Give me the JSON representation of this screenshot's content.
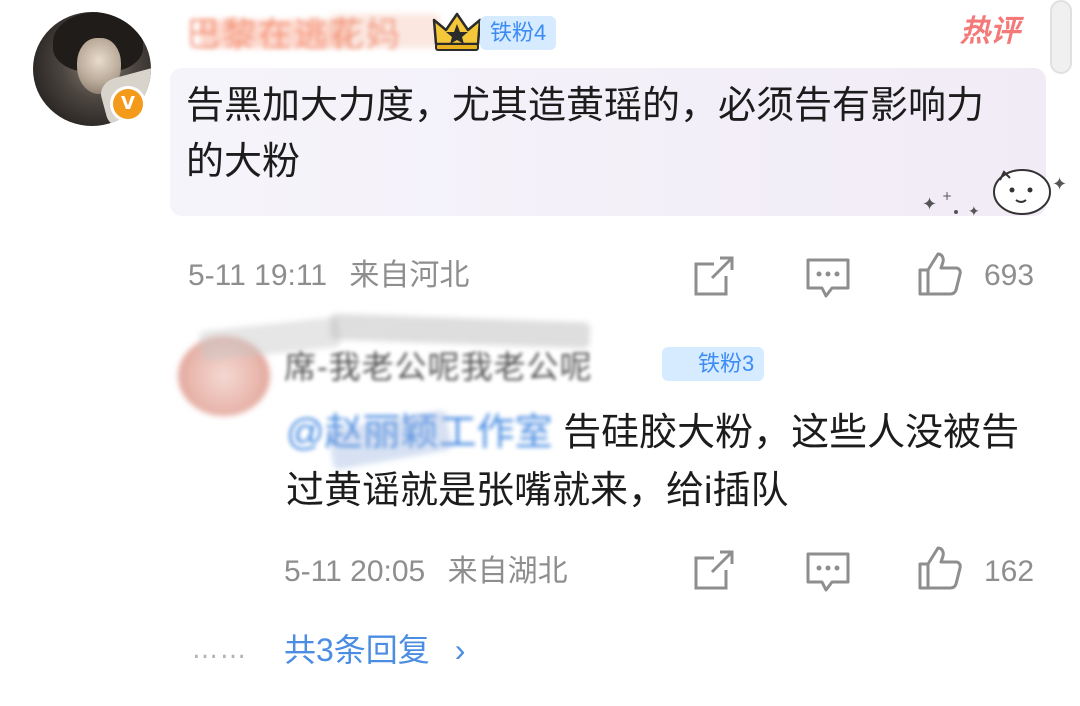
{
  "comment": {
    "username": "巴黎在逃花妈",
    "fan_badge": "铁粉4",
    "hot_tag": "热评",
    "text": "告黑加大力度，尤其造黄瑶的，必须告有影响力的大粉",
    "time": "5-11 19:11",
    "location": "来自河北",
    "likes": "693"
  },
  "reply": {
    "username": "席-我老公呢我老公呢",
    "fan_badge": "铁粉3",
    "mention": "@赵丽颖工作室",
    "text": " 告硅胶大粉，这些人没被告过黄谣就是张嘴就来，给i插队",
    "time": "5-11 20:05",
    "location": "来自湖北",
    "likes": "162"
  },
  "more": {
    "dots": "……",
    "label": "共3条回复",
    "chevron": "›"
  },
  "icons": {
    "crown": "crown-icon",
    "verify": "verified-v-icon",
    "diamond": "diamond-icon",
    "share": "share-icon",
    "comment": "comment-icon",
    "like": "like-icon"
  },
  "colors": {
    "link": "#4a8de2",
    "badge_bg": "#d6ebff",
    "badge_text": "#3c8cf4",
    "verify": "#f49a1b",
    "hot": "#f47a7a",
    "meta": "#8e8e8e"
  }
}
